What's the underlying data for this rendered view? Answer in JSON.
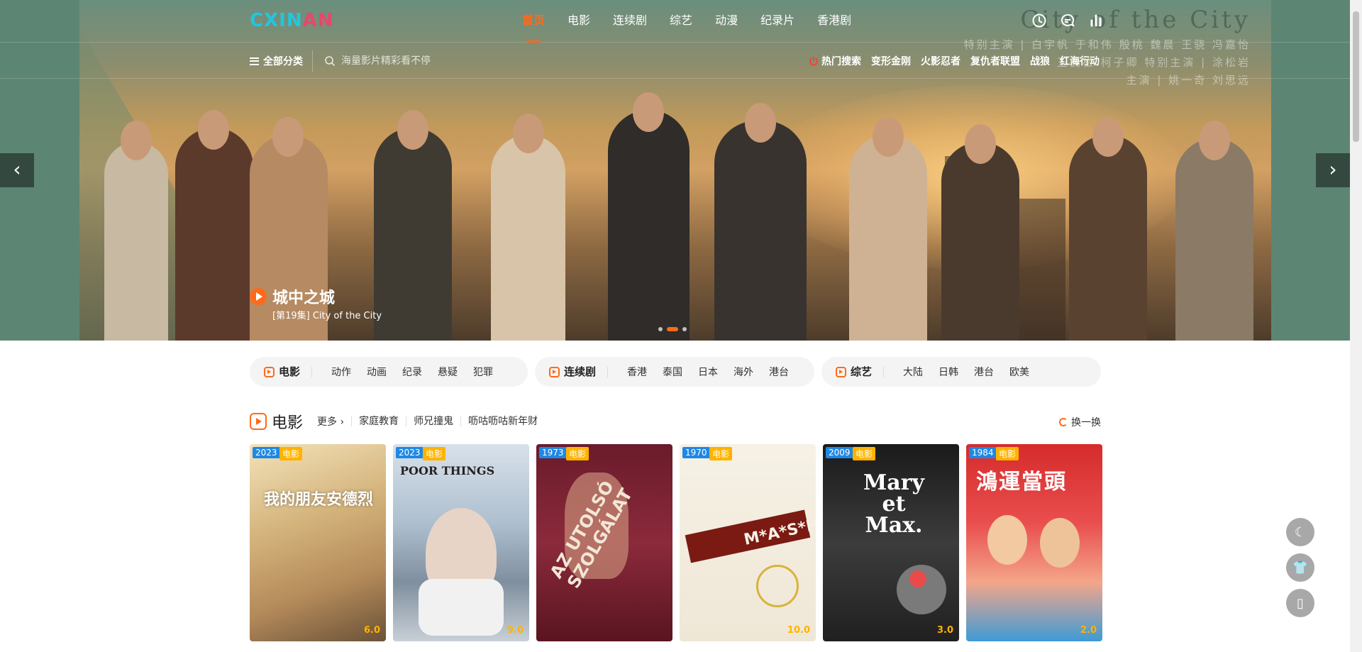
{
  "logo": {
    "c": "C",
    "x": "XIN",
    "a": "AN"
  },
  "nav": {
    "items": [
      "首页",
      "电影",
      "连续剧",
      "综艺",
      "动漫",
      "纪录片",
      "香港剧"
    ]
  },
  "subbar": {
    "all_categories": "全部分类",
    "search_placeholder": "海量影片精彩看不停",
    "hot_label": "热门搜索",
    "hot_items": [
      "变形金刚",
      "火影忍者",
      "复仇者联盟",
      "战狼",
      "红海行动"
    ]
  },
  "hero": {
    "credits_big": "City of the City",
    "credits_line1": "特别主演 | 白宇帆  于和伟  殷桃  魏晨  王骁  冯嘉怡",
    "credits_line2": "王鹤松  柯子卿  特别主演 | 涂松岩",
    "credits_line3": "主演 | 姚一奇  刘思远",
    "title": "城中之城",
    "subtitle": "[第19集] City of the City",
    "prev": "‹",
    "next": "›"
  },
  "categories": [
    {
      "head": "电影",
      "items": [
        "动作",
        "动画",
        "纪录",
        "悬疑",
        "犯罪"
      ]
    },
    {
      "head": "连续剧",
      "items": [
        "香港",
        "泰国",
        "日本",
        "海外",
        "港台"
      ]
    },
    {
      "head": "综艺",
      "items": [
        "大陆",
        "日韩",
        "港台",
        "欧美"
      ]
    }
  ],
  "section": {
    "title": "电影",
    "more": "更多 ›",
    "tags": [
      "家庭教育",
      "师兄撞鬼",
      "呖咕呖咕新年财"
    ],
    "refresh": "换一换"
  },
  "cards": [
    {
      "year": "2023",
      "type": "电影",
      "score": "6.0",
      "poster_text": "我的朋友安德烈"
    },
    {
      "year": "2023",
      "type": "电影",
      "score": "9.0",
      "poster_text": "POOR THINGS"
    },
    {
      "year": "1973",
      "type": "电影",
      "score": "",
      "poster_text": "AZ UTOLSÓ SZOLGÁLAT"
    },
    {
      "year": "1970",
      "type": "电影",
      "score": "10.0",
      "poster_text": "M*A*S*H"
    },
    {
      "year": "2009",
      "type": "电影",
      "score": "3.0",
      "poster_text": "Mary et Max."
    },
    {
      "year": "1984",
      "type": "电影",
      "score": "2.0",
      "poster_text": "鴻運當頭"
    }
  ],
  "fab": [
    "☾",
    "👕",
    "▯"
  ]
}
